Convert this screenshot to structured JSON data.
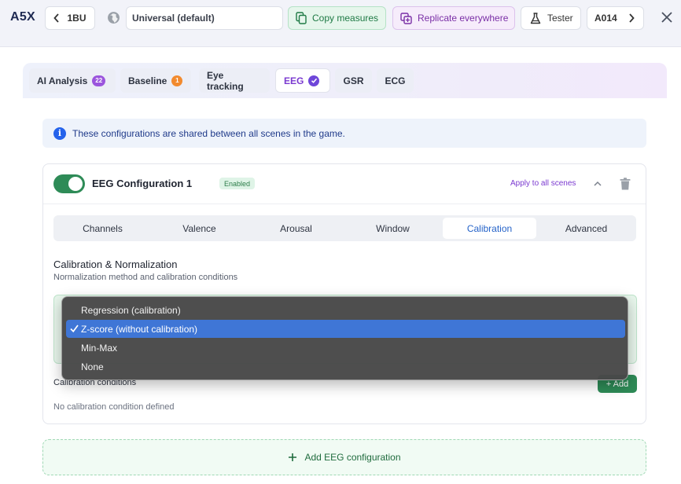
{
  "header": {
    "app_code": "A5X",
    "prev_label": "1BU",
    "scope_value": "Universal (default)",
    "copy_label": "Copy measures",
    "replicate_label": "Replicate everywhere",
    "tester_label": "Tester",
    "next_label": "A014"
  },
  "tabs": [
    {
      "label": "AI Analysis",
      "badge": "22"
    },
    {
      "label": "Baseline",
      "badge": "1"
    },
    {
      "label": "Eye tracking"
    },
    {
      "label": "EEG",
      "active": true
    },
    {
      "label": "GSR"
    },
    {
      "label": "ECG"
    }
  ],
  "info_text": "These configurations are shared between all scenes in the game.",
  "config": {
    "title": "EEG Configuration 1",
    "status": "Enabled",
    "enabled": true,
    "apply_all_label": "Apply to all scenes",
    "subtabs": [
      "Channels",
      "Valence",
      "Arousal",
      "Window",
      "Calibration",
      "Advanced"
    ],
    "active_subtab": "Calibration",
    "section_title": "Calibration & Normalization",
    "section_subtitle": "Normalization method and calibration conditions",
    "calibration_label": "Calibration conditions",
    "add_label": "+ Add",
    "empty_text": "No calibration condition defined"
  },
  "dropdown": {
    "options": [
      "Regression (calibration)",
      "Z-score (without calibration)",
      "Min-Max",
      "None"
    ],
    "selected": "Z-score (without calibration)"
  },
  "add_config_label": "Add EEG configuration",
  "colors": {
    "accent_purple": "#7b3ad0",
    "success_green": "#2e8b57",
    "info_blue": "#2563eb",
    "selection_blue": "#3f76d6"
  }
}
